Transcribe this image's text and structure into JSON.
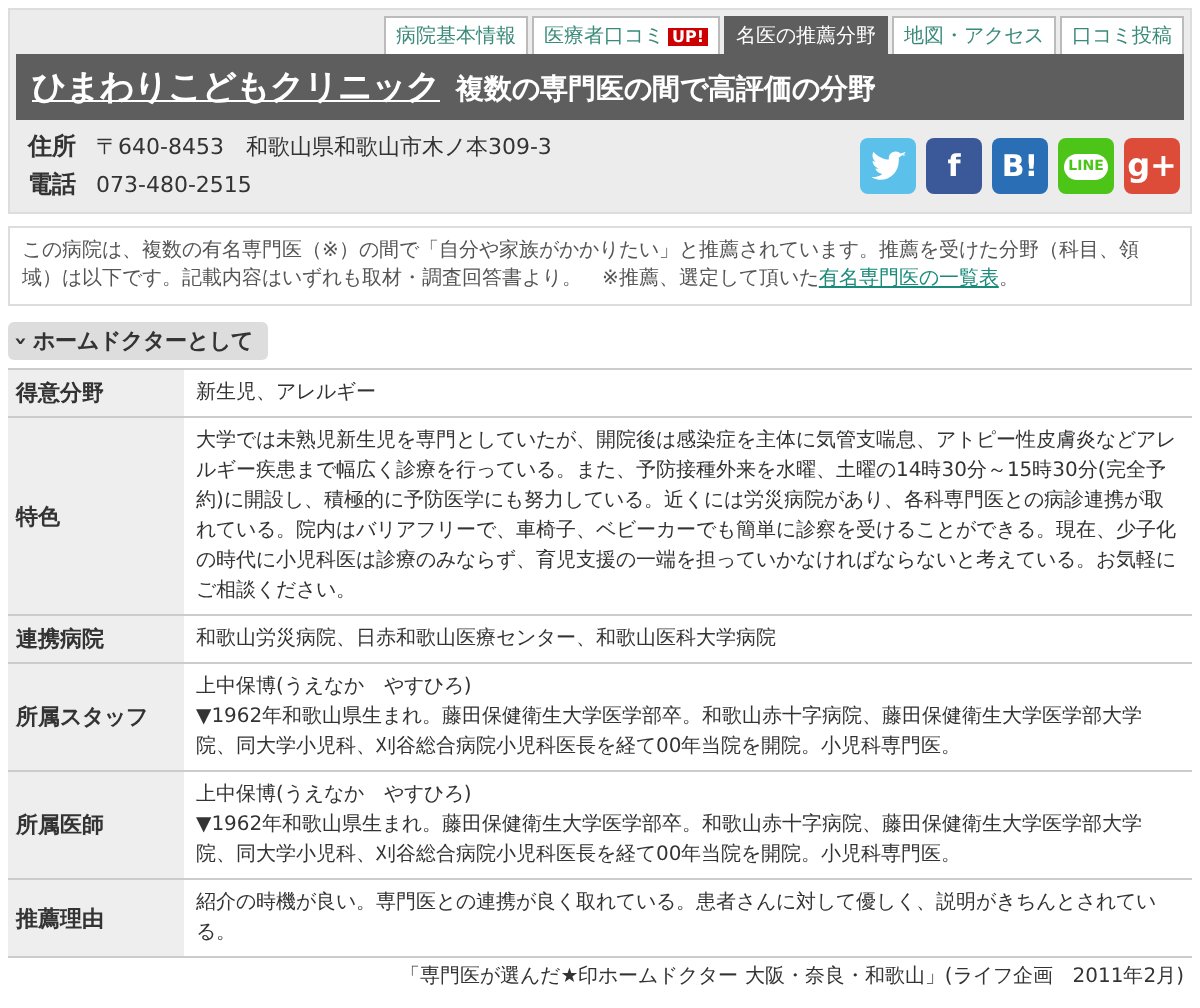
{
  "tabs": [
    {
      "label": "病院基本情報",
      "selected": false
    },
    {
      "label": "医療者口コミ",
      "badge": "UP!",
      "selected": false
    },
    {
      "label": "名医の推薦分野",
      "selected": true
    },
    {
      "label": "地図・アクセス",
      "selected": false
    },
    {
      "label": "口コミ投稿",
      "selected": false
    }
  ],
  "header": {
    "clinic_name": "ひまわりこどもクリニック",
    "subtitle": "複数の専門医の間で高評価の分野"
  },
  "contact": [
    {
      "label": "住所",
      "value": "〒640-8453　和歌山県和歌山市木ノ本309-3"
    },
    {
      "label": "電話",
      "value": "073-480-2515"
    }
  ],
  "share_buttons": [
    {
      "kind": "twitter"
    },
    {
      "kind": "facebook",
      "glyph": "f"
    },
    {
      "kind": "hatena",
      "glyph": "B!"
    },
    {
      "kind": "line",
      "glyph": "LINE"
    },
    {
      "kind": "google",
      "glyph": "g+"
    }
  ],
  "notice": {
    "text": "この病院は、複数の有名専門医（※）の間で「自分や家族がかかりたい」と推薦されています。推薦を受けた分野（科目、領域）は以下です。記載内容はいずれも取材・調査回答書より。　※推薦、選定して頂いた",
    "link": "有名専門医の一覧表",
    "after": "。"
  },
  "section": {
    "caret": "›",
    "title": "ホームドクターとして",
    "expanded": true
  },
  "table": {
    "rows": [
      {
        "label": "得意分野",
        "lines": [
          "新生児、アレルギー"
        ]
      },
      {
        "label": "特色",
        "lines": [
          "大学では未熟児新生児を専門としていたが、開院後は感染症を主体に気管支喘息、アトピー性皮膚炎などアレルギー疾患まで幅広く診療を行っている。また、予防接種外来を水曜、土曜の14時30分～15時30分(完全予約)に開設し、積極的に予防医学にも努力している。近くには労災病院があり、各科専門医との病診連携が取れている。院内はバリアフリーで、車椅子、ベビーカーでも簡単に診察を受けることができる。現在、少子化の時代に小児科医は診療のみならず、育児支援の一端を担っていかなければならないと考えている。お気軽にご相談ください。"
        ]
      },
      {
        "label": "連携病院",
        "lines": [
          "和歌山労災病院、日赤和歌山医療センター、和歌山医科大学病院"
        ]
      },
      {
        "label": "所属スタッフ",
        "lines": [
          "上中保博(うえなか　やすひろ)",
          "▼1962年和歌山県生まれ。藤田保健衛生大学医学部卒。和歌山赤十字病院、藤田保健衛生大学医学部大学院、同大学小児科、刈谷総合病院小児科医長を経て00年当院を開院。小児科専門医。"
        ]
      },
      {
        "label": "所属医師",
        "lines": [
          "上中保博(うえなか　やすひろ)",
          "▼1962年和歌山県生まれ。藤田保健衛生大学医学部卒。和歌山赤十字病院、藤田保健衛生大学医学部大学院、同大学小児科、刈谷総合病院小児科医長を経て00年当院を開院。小児科専門医。"
        ]
      },
      {
        "label": "推薦理由",
        "lines": [
          "紹介の時機が良い。専門医との連携が良く取れている。患者さんに対して優しく、説明がきちんとされている。"
        ]
      }
    ]
  },
  "source": "「専門医が選んだ★印ホームドクター 大阪・奈良・和歌山」(ライフ企画　2011年2月)"
}
